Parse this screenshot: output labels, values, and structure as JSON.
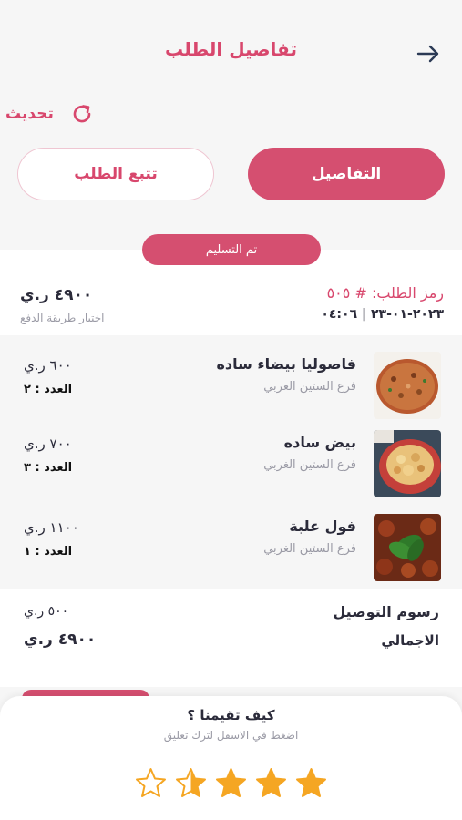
{
  "header": {
    "title": "تفاصيل الطلب"
  },
  "refresh": {
    "label": "تحديث"
  },
  "tabs": [
    {
      "label": "التفاصيل",
      "active": true
    },
    {
      "label": "تتبع الطلب",
      "active": false
    }
  ],
  "order": {
    "status": "تم التسليم",
    "code": "رمز الطلب: # ٥٠٥",
    "datetime": "٢٠٢٣-٠١-٢٣ | ٠٤:٠٦",
    "total": "٤٩٠٠ ر.ي",
    "payment_method": "اختيار طريقة الدفع"
  },
  "items": [
    {
      "name": "فاصوليا بيضاء ساده",
      "branch": "فرع الستين الغربي",
      "price": "٦٠٠ ر.ي",
      "qty": "العدد : ٢"
    },
    {
      "name": "بيض ساده",
      "branch": "فرع الستين الغربي",
      "price": "٧٠٠ ر.ي",
      "qty": "العدد : ٣"
    },
    {
      "name": "فول علبة",
      "branch": "فرع الستين الغربي",
      "price": "١١٠٠ ر.ي",
      "qty": "العدد : ١"
    }
  ],
  "summary": {
    "delivery_label": "رسوم التوصيل",
    "delivery_value": "٥٠٠ ر.ي",
    "total_label": "الاجمالي",
    "total_value": "٤٩٠٠ ر.ي"
  },
  "rating": {
    "title": "كيف تقيمنا ؟",
    "hint": "اضغط في الاسفل لترك تعليق",
    "value": 3.5,
    "max": 5
  },
  "colors": {
    "accent": "#d54f70",
    "star": "#f5a623"
  }
}
